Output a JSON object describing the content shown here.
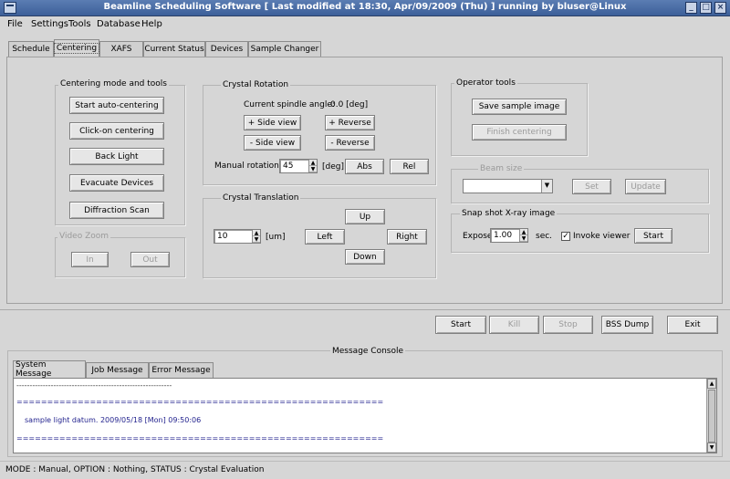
{
  "window": {
    "title": "Beamline Scheduling Software [ Last modified at 18:30, Apr/09/2009 (Thu) ] running by bluser@Linux",
    "buttons": {
      "minimize": "_",
      "maximize": "□",
      "close": "×"
    }
  },
  "menu": [
    "File",
    "Settings",
    "Tools",
    "Database",
    "Help"
  ],
  "tabs": [
    "Schedule",
    "Centering",
    "XAFS",
    "Current Status",
    "Devices",
    "Sample Changer"
  ],
  "centering_mode": {
    "title": "Centering mode and tools",
    "buttons": [
      "Start auto-centering",
      "Click-on centering",
      "Back Light",
      "Evacuate Devices",
      "Diffraction Scan"
    ]
  },
  "video_zoom": {
    "title": "Video Zoom",
    "in": "In",
    "out": "Out"
  },
  "crystal_rotation": {
    "title": "Crystal Rotation",
    "spindle_label": "Current spindle angle:",
    "spindle_value": "0.0 [deg]",
    "plus_side": "+ Side view",
    "plus_reverse": "+ Reverse",
    "minus_side": "- Side view",
    "minus_reverse": "- Reverse",
    "manual_label": "Manual rotation",
    "manual_value": "45",
    "unit": "[deg]",
    "abs": "Abs",
    "rel": "Rel"
  },
  "crystal_translation": {
    "title": "Crystal Translation",
    "value": "10",
    "unit": "[um]",
    "up": "Up",
    "left": "Left",
    "right": "Right",
    "down": "Down"
  },
  "operator_tools": {
    "title": "Operator tools",
    "save": "Save sample image",
    "finish": "Finish centering"
  },
  "beam_size": {
    "title": "Beam size",
    "set": "Set",
    "update": "Update"
  },
  "snapshot": {
    "title": "Snap shot X-ray image",
    "expose_label": "Expose",
    "expose_value": "1.00",
    "unit": "sec.",
    "invoke_label": "Invoke viewer",
    "invoke_checked": true,
    "start": "Start"
  },
  "controls": [
    "Start",
    "Kill",
    "Stop",
    "BSS Dump",
    "Exit"
  ],
  "console": {
    "title": "Message Console",
    "tabs": [
      "System Message",
      "Job Message",
      "Error Message"
    ],
    "lines": [
      "-----------------------------------------------------------",
      "============================================================",
      "sample light datum. 2009/05/18 [Mon] 09:50:06",
      "============================================================"
    ]
  },
  "status": "MODE : Manual,    OPTION : Nothing,    STATUS : Crystal Evaluation"
}
